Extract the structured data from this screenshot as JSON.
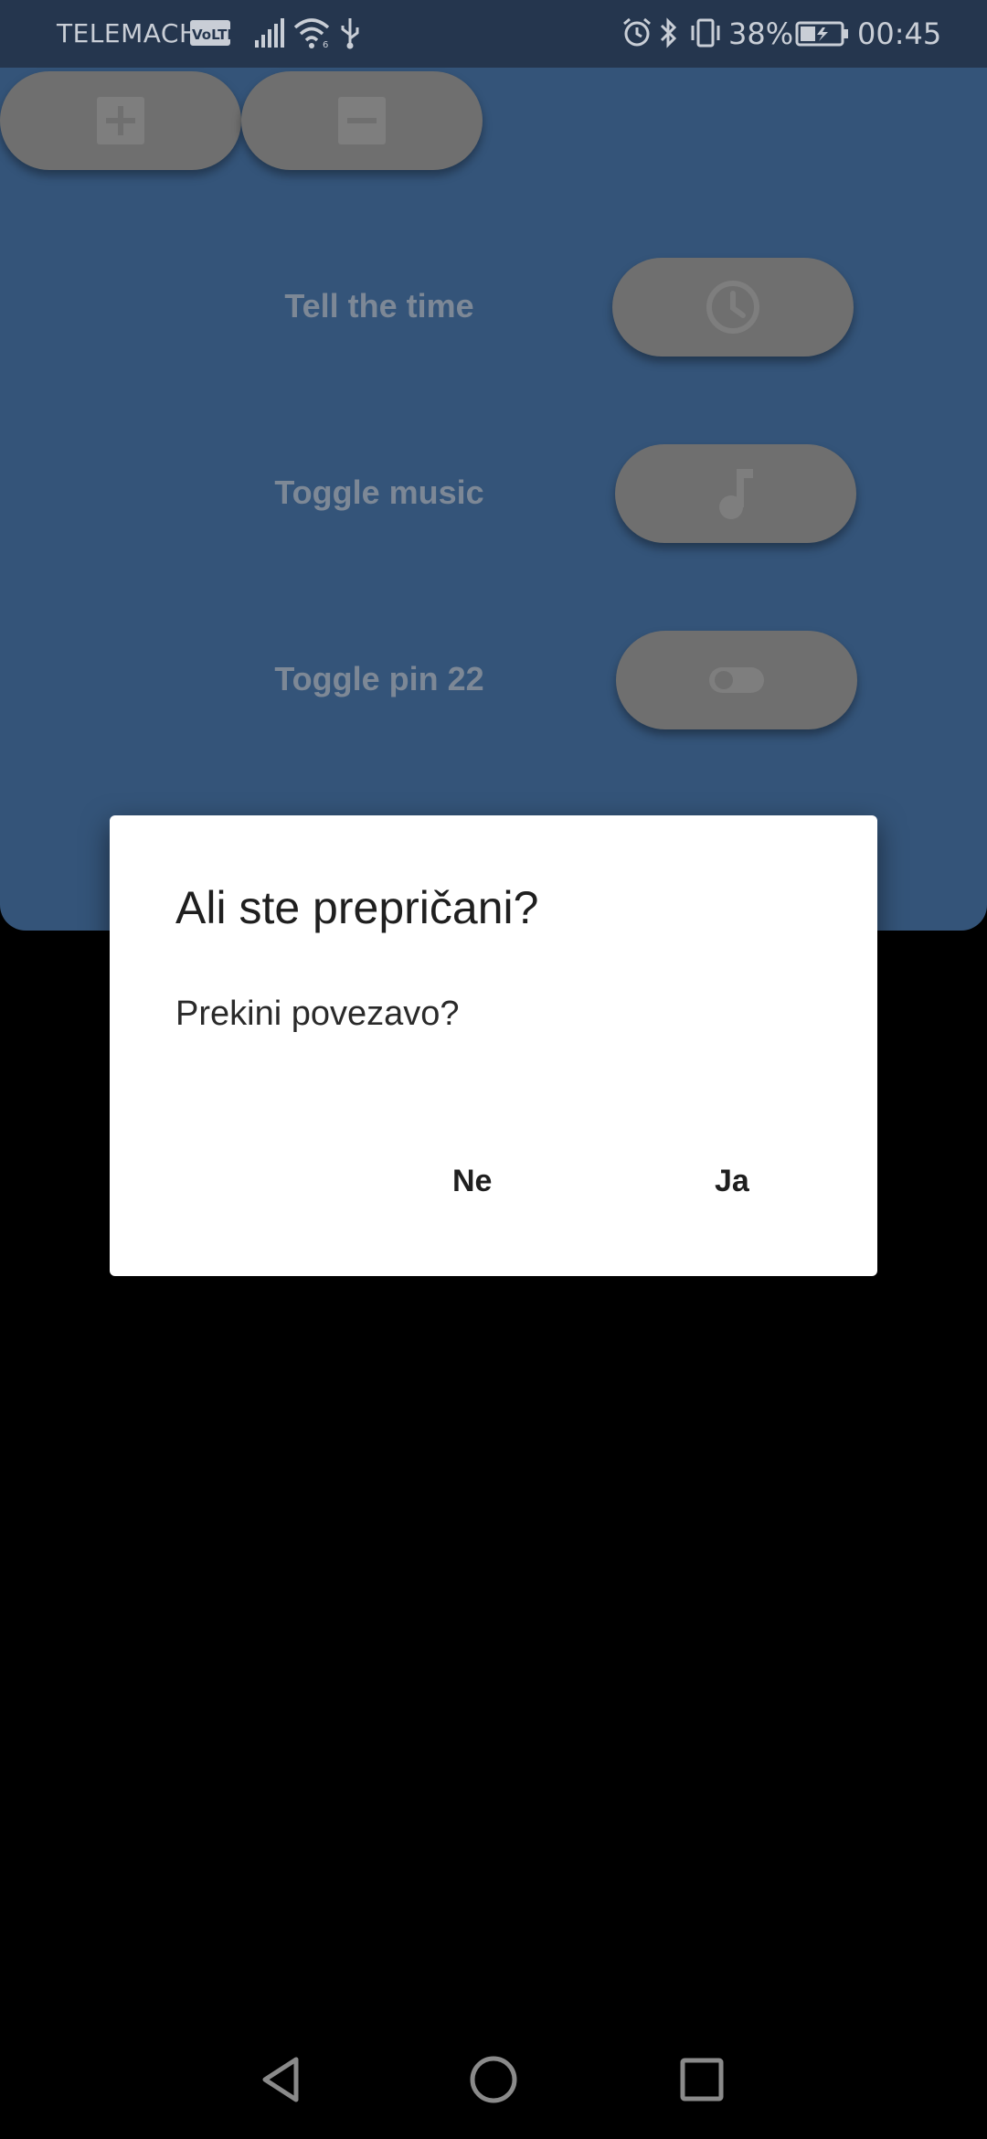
{
  "status_bar": {
    "carrier": "TELEMACH",
    "volte": "VoLTE",
    "battery_percent": "38%",
    "time": "00:45"
  },
  "app": {
    "zoom_in_icon": "plus-icon",
    "zoom_out_icon": "minus-icon",
    "actions": [
      {
        "label": "Tell the time",
        "icon": "clock-icon"
      },
      {
        "label": "Toggle music",
        "icon": "music-note-icon"
      },
      {
        "label": "Toggle pin 22",
        "icon": "toggle-switch-icon"
      }
    ]
  },
  "dialog": {
    "title": "Ali ste prepričani?",
    "message": "Prekini povezavo?",
    "no_label": "Ne",
    "yes_label": "Ja"
  },
  "nav_bar": {
    "back_icon": "back-triangle-icon",
    "home_icon": "home-circle-icon",
    "recents_icon": "recents-square-icon"
  },
  "colors": {
    "status_bar_bg": "#25364e",
    "app_bg": "#345479",
    "button_bg": "#6f6f6f",
    "dialog_bg": "#ffffff",
    "screen_bg": "#000000"
  }
}
